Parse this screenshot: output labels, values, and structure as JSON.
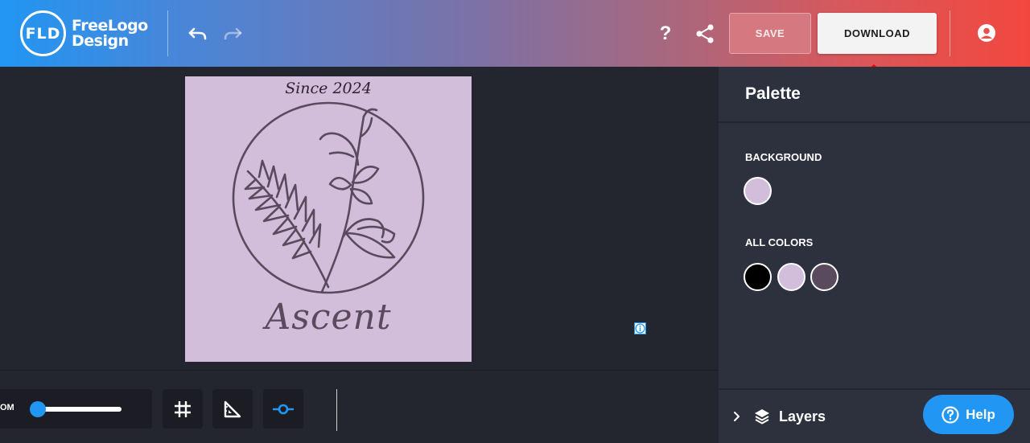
{
  "header": {
    "logo_mark": "FLD",
    "logo_line1": "FreeLogo",
    "logo_line2": "Design",
    "undo_icon": "undo-icon",
    "redo_icon": "redo-icon",
    "help_glyph": "?",
    "share_icon": "share-icon",
    "save_label": "SAVE",
    "download_label": "DOWNLOAD",
    "account_icon": "account-icon"
  },
  "annotation": {
    "icon": "red-up-arrow",
    "color": "#ff0000"
  },
  "canvas": {
    "background_color": "#d2bdda",
    "tagline": "Since 2024",
    "brand_name": "Ascent",
    "emblem_color": "#5a4a5d"
  },
  "toolbar": {
    "zoom_label": "OM",
    "zoom_level": 0.07,
    "grid_icon": "grid-icon",
    "ruler_icon": "ruler-icon",
    "snap_icon": "snap-icon",
    "snap_active": true
  },
  "ad": {
    "icon": "info-icon"
  },
  "palette": {
    "title": "Palette",
    "background_label": "BACKGROUND",
    "background_color": "#d2bdda",
    "all_colors_label": "ALL COLORS",
    "all_colors": [
      "#000000",
      "#d2bdda",
      "#5a4a5d"
    ]
  },
  "layers": {
    "label": "Layers",
    "icon": "layers-icon",
    "chevron": "chevron-right-icon"
  },
  "help": {
    "label": "Help",
    "icon": "question-circle-icon"
  },
  "colors": {
    "accent": "#2196f3",
    "panel": "#2d303d",
    "workspace": "#23252f"
  }
}
